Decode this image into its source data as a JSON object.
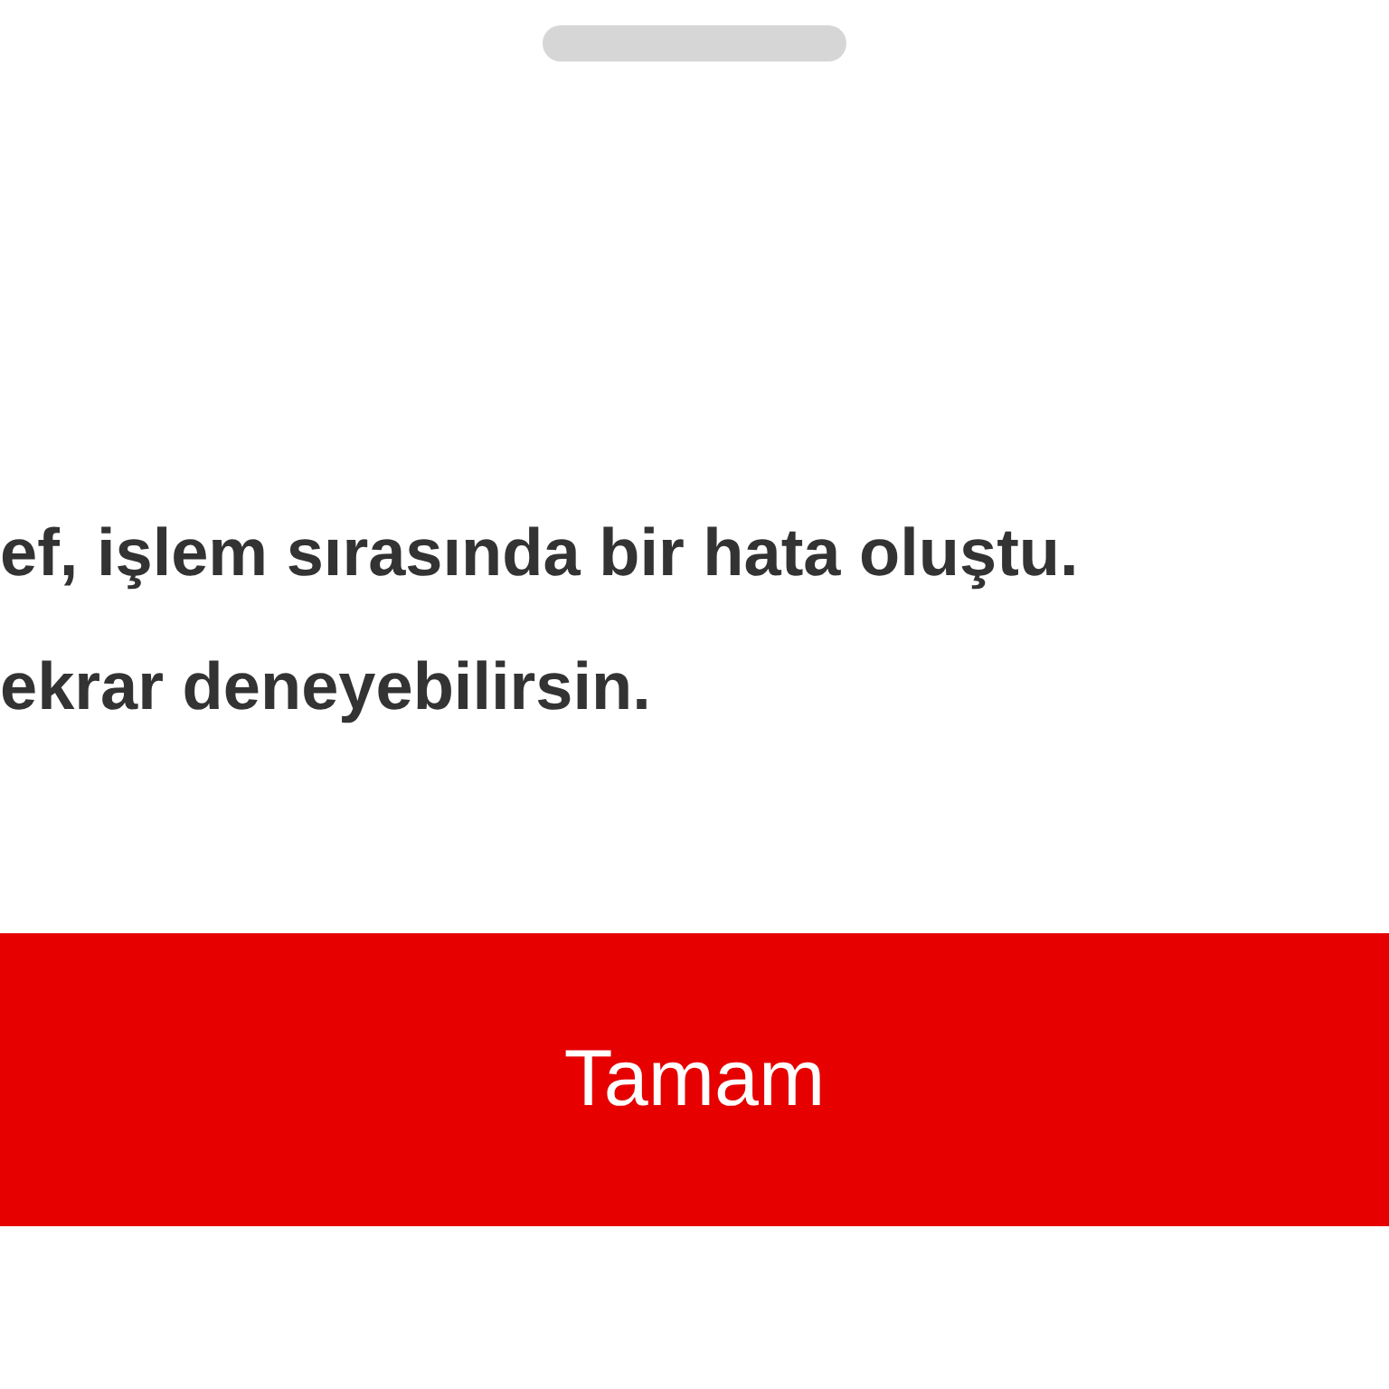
{
  "sheet": {
    "message_lines": [
      "ef, işlem sırasında bir hata oluştu.",
      "ekrar deneyebilirsin."
    ],
    "button": "Tamam"
  }
}
